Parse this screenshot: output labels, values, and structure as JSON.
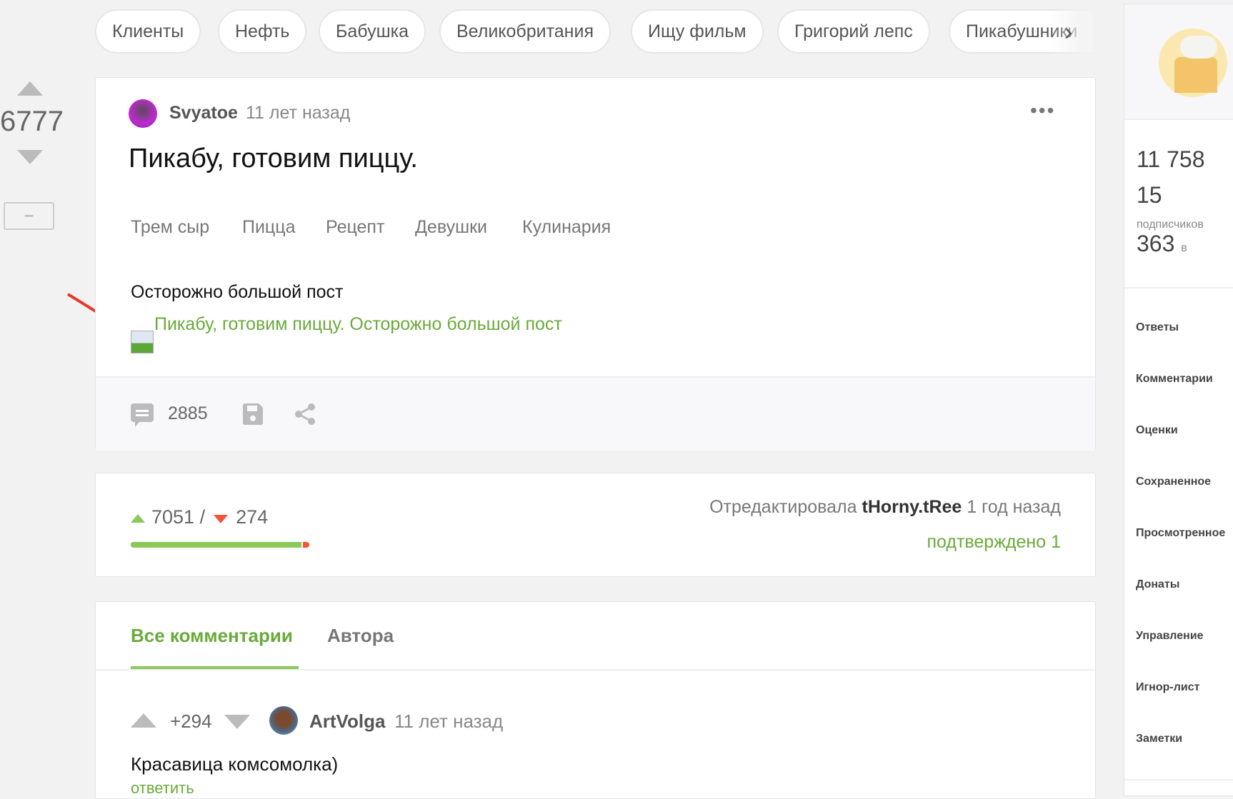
{
  "tags_bar": {
    "chips": [
      "Клиенты",
      "Нефть",
      "Бабушка",
      "Великобритания",
      "Ищу фильм",
      "Григорий лепс",
      "Пикабушники"
    ]
  },
  "vote": {
    "rating": "6777",
    "collapse_label": "–"
  },
  "post": {
    "author": "Svyatoe",
    "time": "11 лет назад",
    "title": "Пикабу, готовим пиццу.",
    "tags": [
      "Трем сыр",
      "Пицца",
      "Рецепт",
      "Девушки",
      "Кулинария"
    ],
    "text": "Осторожно большой пост",
    "image_alt": "Пикабу, готовим пиццу. Осторожно большой пост",
    "comments_count": "2885"
  },
  "rating": {
    "up": "7051",
    "separator": "/",
    "down": "274",
    "up_fraction": 0.9626,
    "edited_label": "Отредактировала",
    "editor": "tHorny.tRee",
    "edited_time": "1 год назад",
    "confirmed_label": "подтверждено",
    "confirmed_count": "1"
  },
  "comments": {
    "tabs": [
      "Все комментарии",
      "Автора"
    ],
    "items": [
      {
        "score": "+294",
        "author": "ArtVolga",
        "time": "11 лет назад",
        "text": "Красавица комсомолка)",
        "reply": "ответить"
      }
    ]
  },
  "sidebar": {
    "stats": [
      {
        "value": "11 758",
        "label": ""
      },
      {
        "value": "15",
        "label": "подписчиков"
      },
      {
        "value": "363",
        "label": "в"
      }
    ],
    "menu": [
      "Ответы",
      "Комментарии",
      "Оценки",
      "Сохраненное",
      "Просмотренное",
      "Донаты",
      "Управление",
      "Игнор-лист",
      "Заметки"
    ]
  },
  "colors": {
    "green": "#8ac858",
    "red": "#f4553a",
    "link_green": "#6aaa3a"
  }
}
